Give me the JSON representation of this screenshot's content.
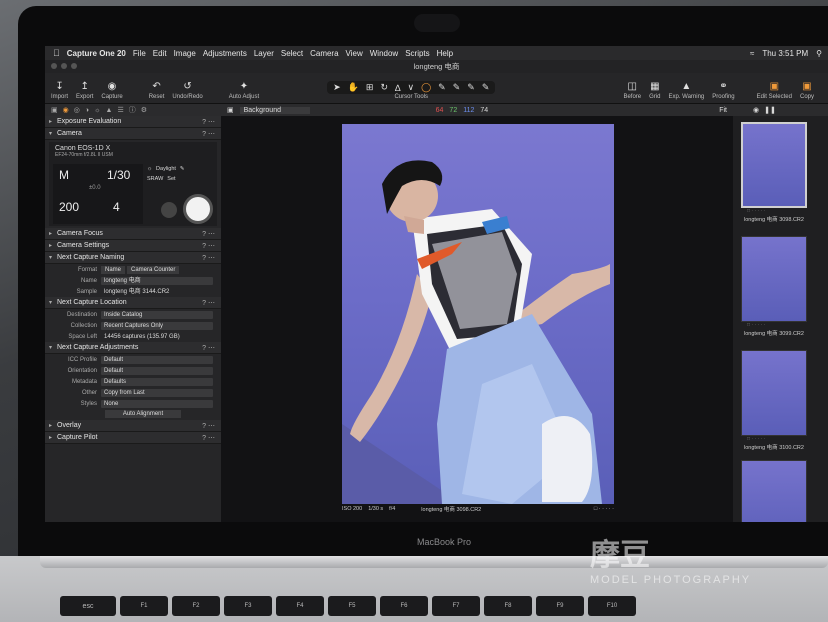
{
  "menubar": {
    "app": "Capture One 20",
    "items": [
      "File",
      "Edit",
      "Image",
      "Adjustments",
      "Layer",
      "Select",
      "Camera",
      "View",
      "Window",
      "Scripts",
      "Help"
    ],
    "clock": "Thu 3:51 PM"
  },
  "window": {
    "title": "longteng 电商"
  },
  "toolbar": {
    "left": [
      "Import",
      "Export",
      "Capture"
    ],
    "middle": [
      "Reset",
      "Undo/Redo"
    ],
    "auto_adjust": "Auto Adjust",
    "cursor_tools": "Cursor Tools",
    "right": [
      "Before",
      "Grid",
      "Exp. Warning",
      "Proofing"
    ],
    "edit_selected": "Edit Selected",
    "copy": "Copy"
  },
  "left_panel": {
    "exposure_evaluation": "Exposure Evaluation",
    "camera": {
      "title": "Camera",
      "model": "Canon EOS-1D X",
      "lens": "EF24-70mm f/2.8L II USM",
      "mode": "M",
      "shutter": "1/30",
      "ev": "±0.0",
      "iso": "200",
      "aperture": "4",
      "daylight": "Daylight",
      "format": "SRAW",
      "set": "Set"
    },
    "camera_focus": "Camera Focus",
    "camera_settings": "Camera Settings",
    "naming": {
      "title": "Next Capture Naming",
      "format_label": "Format",
      "format_tokens": [
        "Name",
        "Camera Counter"
      ],
      "name_label": "Name",
      "name_value": "longteng 电商",
      "sample_label": "Sample",
      "sample_value": "longteng 电商 3144.CR2"
    },
    "location": {
      "title": "Next Capture Location",
      "destination_label": "Destination",
      "destination_value": "Inside Catalog",
      "collection_label": "Collection",
      "collection_value": "Recent Captures Only",
      "space_label": "Space Left",
      "space_value": "14456 captures (135.97 GB)"
    },
    "adjustments": {
      "title": "Next Capture Adjustments",
      "rows": [
        {
          "label": "ICC Profile",
          "value": "Default"
        },
        {
          "label": "Orientation",
          "value": "Default"
        },
        {
          "label": "Metadata",
          "value": "Defaults"
        },
        {
          "label": "Other",
          "value": "Copy from Last"
        },
        {
          "label": "Styles",
          "value": "None"
        }
      ],
      "auto_alignment": "Auto Alignment"
    },
    "overlay": "Overlay",
    "capture_pilot": "Capture Pilot"
  },
  "viewer": {
    "background": "Background",
    "rgb": {
      "r": "64",
      "g": "72",
      "b": "112",
      "l": "74"
    },
    "fit": "Fit",
    "caption": {
      "iso": "ISO 200",
      "shutter": "1/30 s",
      "aperture": "f/4",
      "file": "longteng 电商 3098.CR2"
    }
  },
  "filmstrip": [
    {
      "name": "longteng 电商 3098.CR2",
      "selected": true
    },
    {
      "name": "longteng 电商 3099.CR2",
      "selected": false
    },
    {
      "name": "longteng 电商 3100.CR2",
      "selected": false
    },
    {
      "name": "",
      "selected": false
    }
  ],
  "device": {
    "brand": "MacBook Pro",
    "keys": [
      "esc",
      "F1",
      "F2",
      "F3",
      "F4",
      "F5",
      "F6",
      "F7",
      "F8",
      "F9",
      "F10"
    ]
  },
  "watermark": {
    "main": "摩豆",
    "sub": "MODEL PHOTOGRAPHY"
  },
  "colors": {
    "accent": "#f09a3a",
    "backdrop": "#6c6cc8"
  }
}
